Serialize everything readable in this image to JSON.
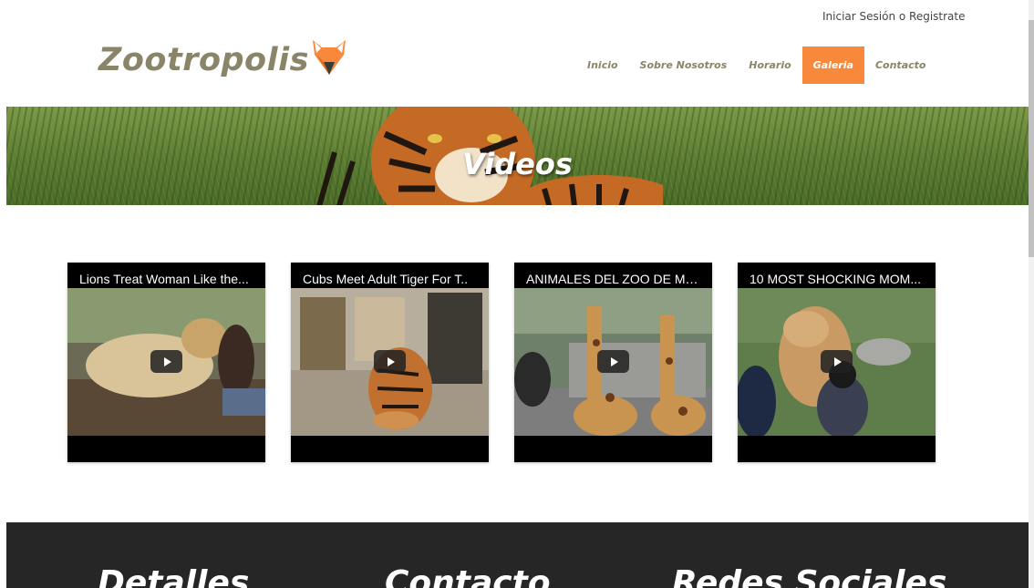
{
  "header": {
    "login_text": "Iniciar Sesión o Registrate",
    "logo_text": "Zootropolis",
    "logo_icon": "fox-icon",
    "accent_color": "#f7883c",
    "nav": [
      {
        "label": "Inicio",
        "active": false
      },
      {
        "label": "Sobre Nosotros",
        "active": false
      },
      {
        "label": "Horario",
        "active": false
      },
      {
        "label": "Galeria",
        "active": true
      },
      {
        "label": "Contacto",
        "active": false
      }
    ]
  },
  "banner": {
    "title": "Videos"
  },
  "videos": [
    {
      "title": "Lions Treat Woman Like the...",
      "icon": "play-icon"
    },
    {
      "title": "Cubs Meet Adult Tiger For T..",
      "icon": "play-icon"
    },
    {
      "title": "ANIMALES DEL ZOO DE MA...",
      "icon": "play-icon"
    },
    {
      "title": "10 MOST SHOCKING MOM...",
      "icon": "play-icon"
    }
  ],
  "footer": {
    "headings": [
      "Detalles",
      "Contacto",
      "Redes Sociales"
    ]
  }
}
